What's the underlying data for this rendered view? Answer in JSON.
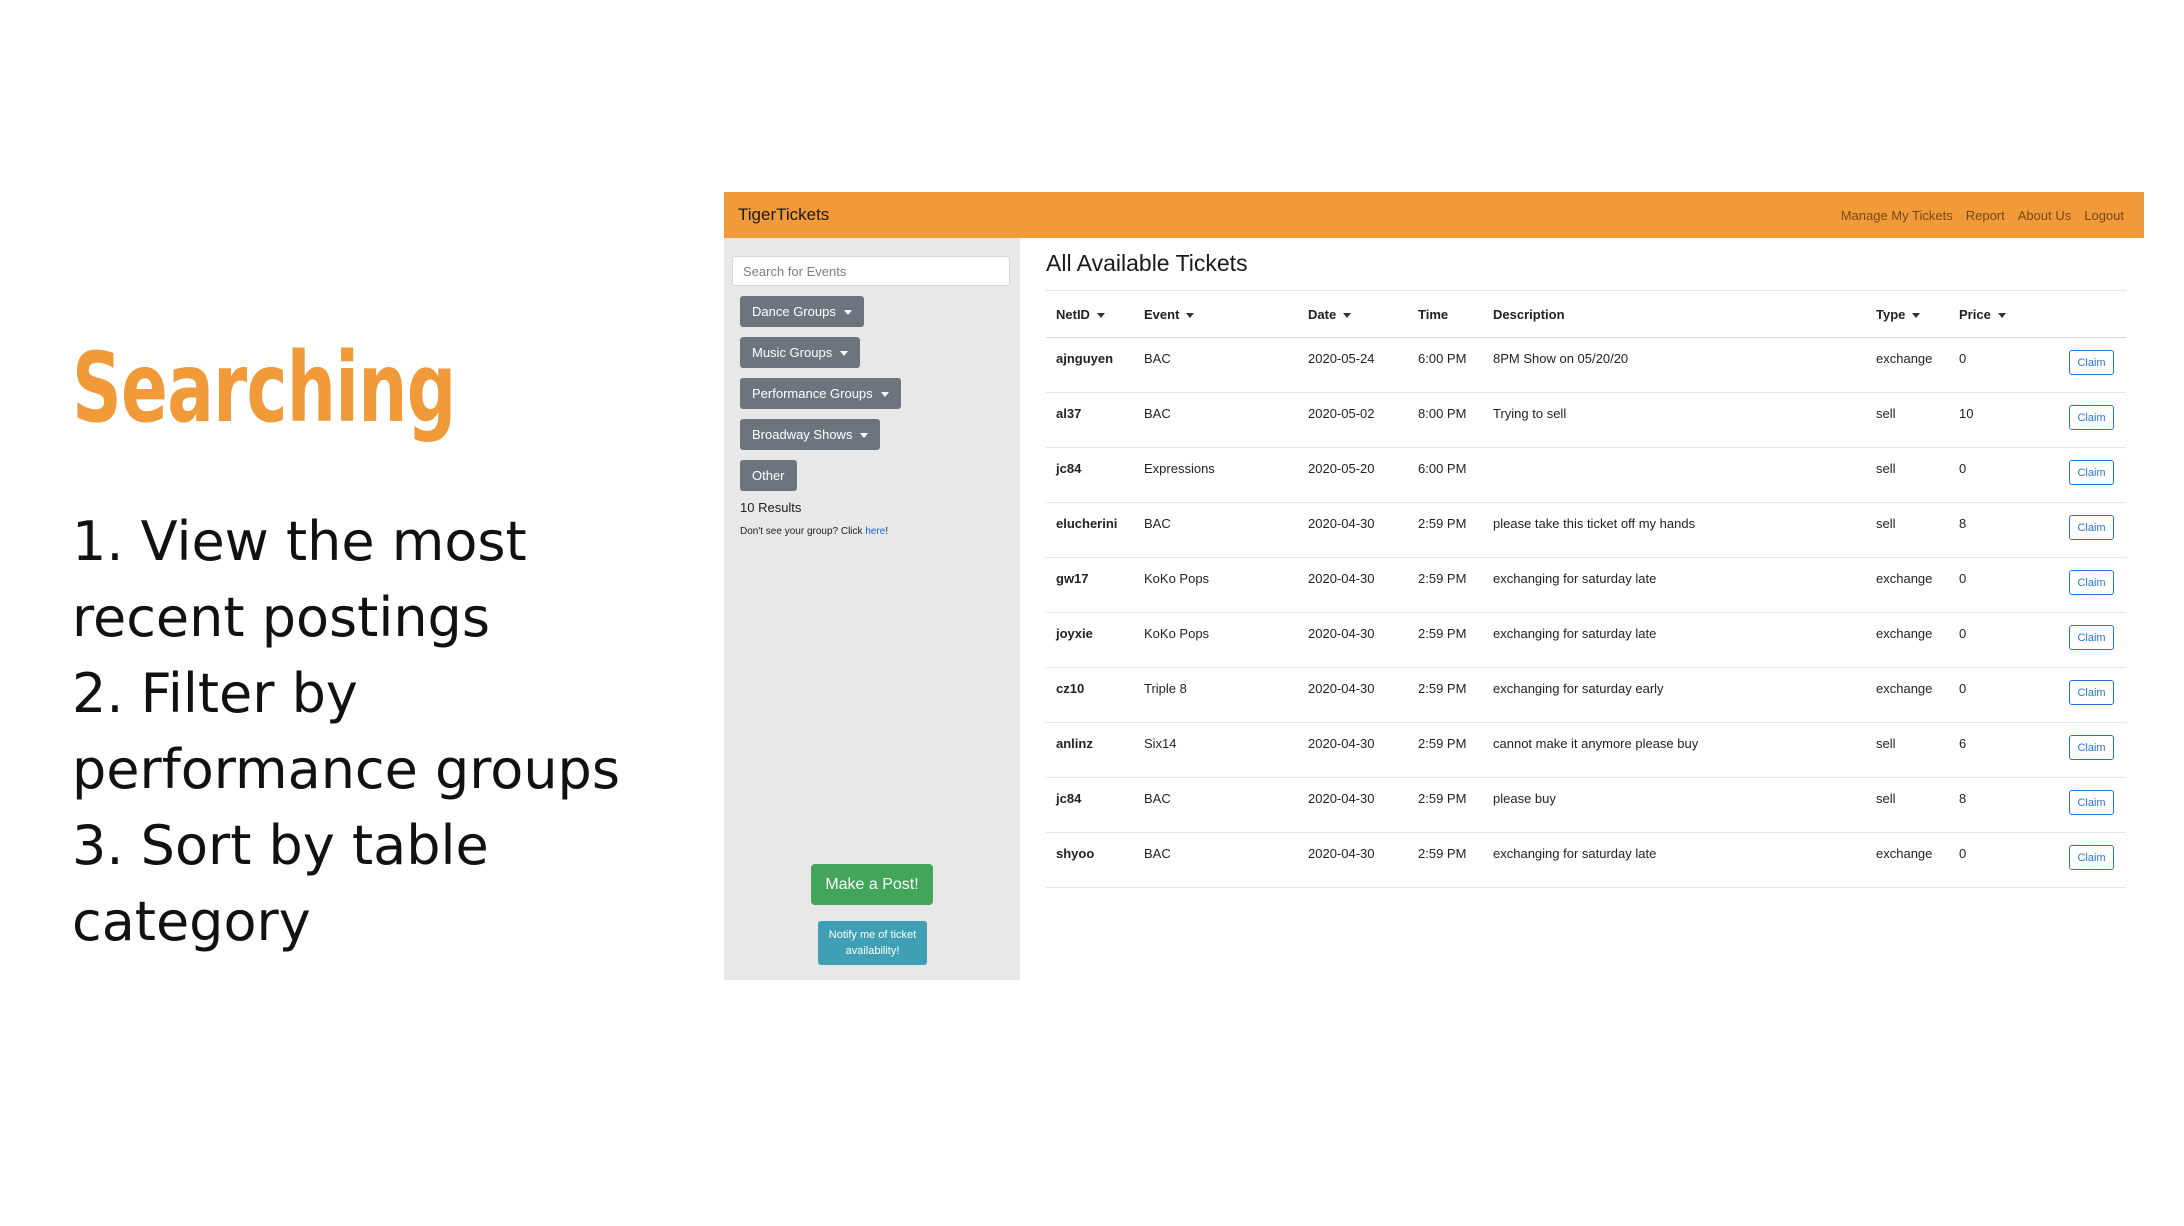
{
  "slide": {
    "title": "Searching",
    "steps": [
      "1. View the most recent postings",
      "2. Filter by performance groups",
      "3. Sort by table category"
    ]
  },
  "navbar": {
    "brand": "TigerTickets",
    "links": [
      "Manage My Tickets",
      "Report",
      "About Us",
      "Logout"
    ],
    "color": "#f09a3a"
  },
  "sidebar": {
    "search_placeholder": "Search for Events",
    "filters": [
      "Dance Groups",
      "Music Groups",
      "Performance Groups",
      "Broadway Shows",
      "Other"
    ],
    "results": "10 Results",
    "group_note_prefix": "Don't see your group? Click ",
    "group_note_link": "here",
    "group_note_suffix": "!",
    "post_button": "Make a Post!",
    "notify_button": "Notify me of ticket availability!"
  },
  "main": {
    "title": "All Available Tickets",
    "columns": [
      "NetID",
      "Event",
      "Date",
      "Time",
      "Description",
      "Type",
      "Price"
    ],
    "claim_label": "Claim",
    "rows": [
      {
        "netid": "ajnguyen",
        "event": "BAC",
        "date": "2020-05-24",
        "time": "6:00 PM",
        "description": "8PM Show on 05/20/20",
        "type": "exchange",
        "price": "0"
      },
      {
        "netid": "al37",
        "event": "BAC",
        "date": "2020-05-02",
        "time": "8:00 PM",
        "description": "Trying to sell",
        "type": "sell",
        "price": "10"
      },
      {
        "netid": "jc84",
        "event": "Expressions",
        "date": "2020-05-20",
        "time": "6:00 PM",
        "description": "",
        "type": "sell",
        "price": "0"
      },
      {
        "netid": "elucherini",
        "event": "BAC",
        "date": "2020-04-30",
        "time": "2:59 PM",
        "description": "please take this ticket off my hands",
        "type": "sell",
        "price": "8"
      },
      {
        "netid": "gw17",
        "event": "KoKo Pops",
        "date": "2020-04-30",
        "time": "2:59 PM",
        "description": "exchanging for saturday late",
        "type": "exchange",
        "price": "0"
      },
      {
        "netid": "joyxie",
        "event": "KoKo Pops",
        "date": "2020-04-30",
        "time": "2:59 PM",
        "description": "exchanging for saturday late",
        "type": "exchange",
        "price": "0"
      },
      {
        "netid": "cz10",
        "event": "Triple 8",
        "date": "2020-04-30",
        "time": "2:59 PM",
        "description": "exchanging for saturday early",
        "type": "exchange",
        "price": "0"
      },
      {
        "netid": "anlinz",
        "event": "Six14",
        "date": "2020-04-30",
        "time": "2:59 PM",
        "description": "cannot make it anymore please buy",
        "type": "sell",
        "price": "6"
      },
      {
        "netid": "jc84",
        "event": "BAC",
        "date": "2020-04-30",
        "time": "2:59 PM",
        "description": "please buy",
        "type": "sell",
        "price": "8"
      },
      {
        "netid": "shyoo",
        "event": "BAC",
        "date": "2020-04-30",
        "time": "2:59 PM",
        "description": "exchanging for saturday late",
        "type": "exchange",
        "price": "0"
      }
    ]
  }
}
